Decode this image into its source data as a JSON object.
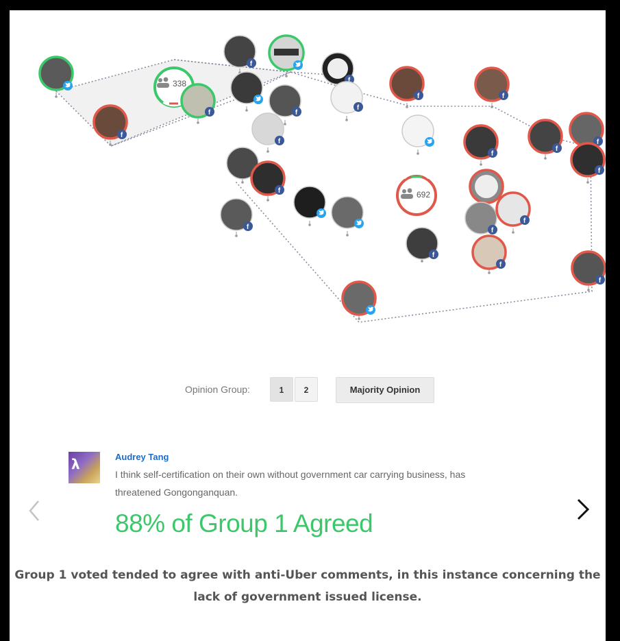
{
  "map": {
    "groups": [
      {
        "label": "Group 1",
        "count": "338",
        "agree_color": "#3cc86a",
        "disagree_color": "#e0584a"
      },
      {
        "label": "Group 2",
        "count": "692",
        "agree_color": "#3cc86a",
        "disagree_color": "#e0584a"
      }
    ],
    "icons": {
      "group": "people-icon",
      "facebook": "facebook-badge-icon",
      "twitter": "twitter-badge-icon"
    }
  },
  "controls": {
    "opinion_group_label": "Opinion Group:",
    "group_buttons": [
      "1",
      "2"
    ],
    "majority_label": "Majority Opinion"
  },
  "comment": {
    "author": "Audrey Tang",
    "text": "I think self-certification on their own without government car carrying business, has threatened Gongonganquan.",
    "stat": "88% of Group 1 Agreed"
  },
  "caption": "Group 1 voted tended to agree with anti-Uber comments, in this instance concerning the lack of government issued license.",
  "colors": {
    "agree": "#3cc86a",
    "disagree": "#e0584a",
    "facebook": "#3b5998",
    "twitter": "#2aa3ef"
  }
}
